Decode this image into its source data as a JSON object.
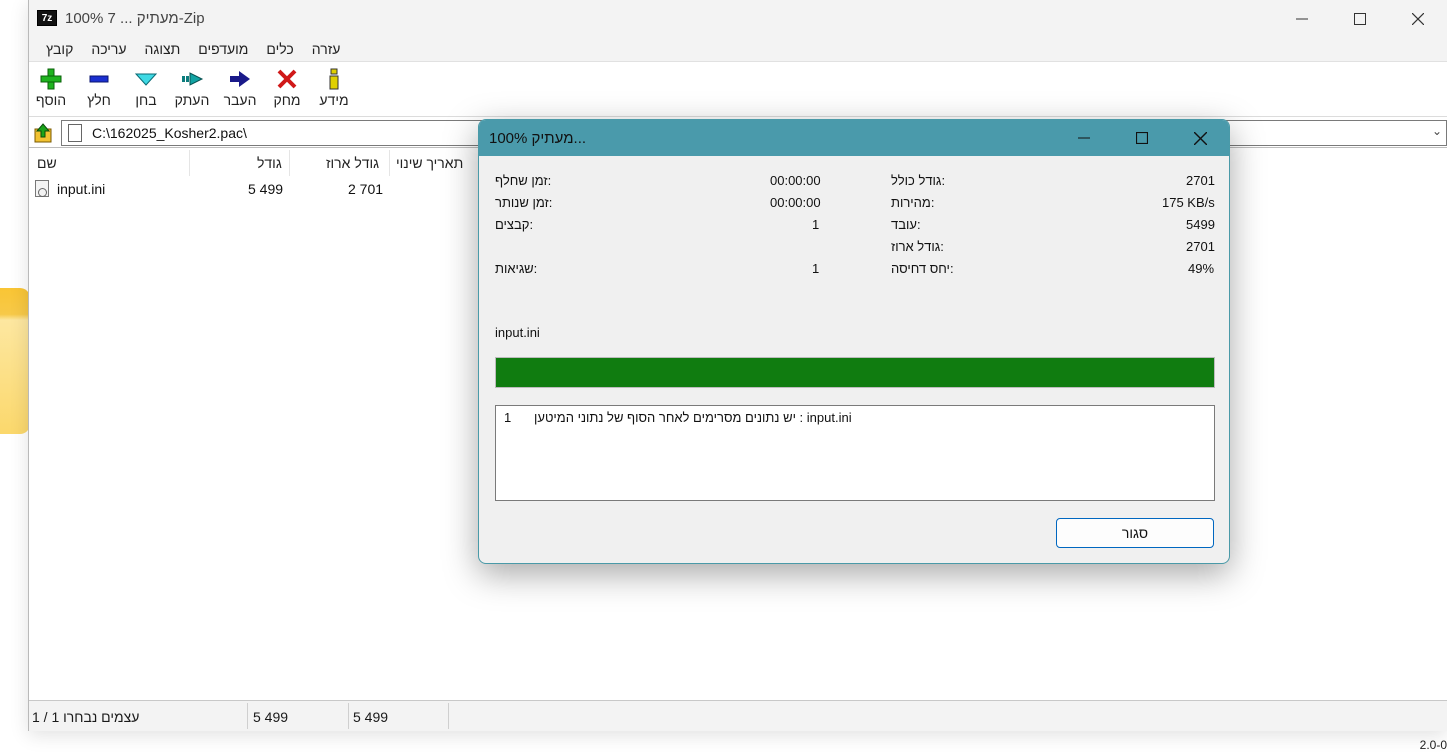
{
  "window": {
    "title": "100% מעתיק ... 7-Zip",
    "icon_text": "7z",
    "minimize_icon": "minimize-icon",
    "maximize_icon": "maximize-icon",
    "close_icon": "close-icon"
  },
  "menu": [
    "קובץ",
    "עריכה",
    "תצוגה",
    "מועדפים",
    "כלים",
    "עזרה"
  ],
  "toolbar": {
    "add": "הוסף",
    "extract": "חלץ",
    "test": "בחן",
    "copy": "העתק",
    "move": "העבר",
    "delete": "מחק",
    "info": "מידע"
  },
  "address": {
    "path": "C:\\162025_Kosher2.pac\\"
  },
  "list": {
    "headers": {
      "name": "שם",
      "size": "גודל",
      "packed": "גודל ארוז",
      "modified": "תאריך שינוי"
    },
    "rows": [
      {
        "name": "input.ini",
        "size": "5 499",
        "packed": "2 701"
      }
    ]
  },
  "status": {
    "selected": "1 / 1 עצמים נבחרו",
    "size": "5 499",
    "packed": "5 499"
  },
  "dialog": {
    "title": "100% מעתיק...",
    "elapsed_label": "זמן שחלף:",
    "elapsed_value": "00:00:00",
    "remaining_label": "זמן שנותר:",
    "remaining_value": "00:00:00",
    "files_label": "קבצים:",
    "files_value": "1",
    "errors_label": "שגיאות:",
    "errors_value": "1",
    "total_size_label": "גודל כולל:",
    "total_size_value": "2701",
    "speed_label": "מהירות:",
    "speed_value": "175 KB/s",
    "processed_label": "עובד:",
    "processed_value": "5499",
    "packed_size_label": "גודל ארוז:",
    "packed_size_value": "2701",
    "ratio_label": "יחס דחיסה:",
    "ratio_value": "49%",
    "current_file": "input.ini",
    "progress_fraction": 1.0,
    "log_message": "input.ini : יש נתונים מסרימים לאחר הסוף של נתוני המיטען",
    "log_count": "1",
    "close_button": "סגור"
  },
  "colors": {
    "progress": "#107c10",
    "dialog_title": "#4a9aab",
    "button_border": "#0067c0"
  },
  "desktop_corner": "2.0-0"
}
